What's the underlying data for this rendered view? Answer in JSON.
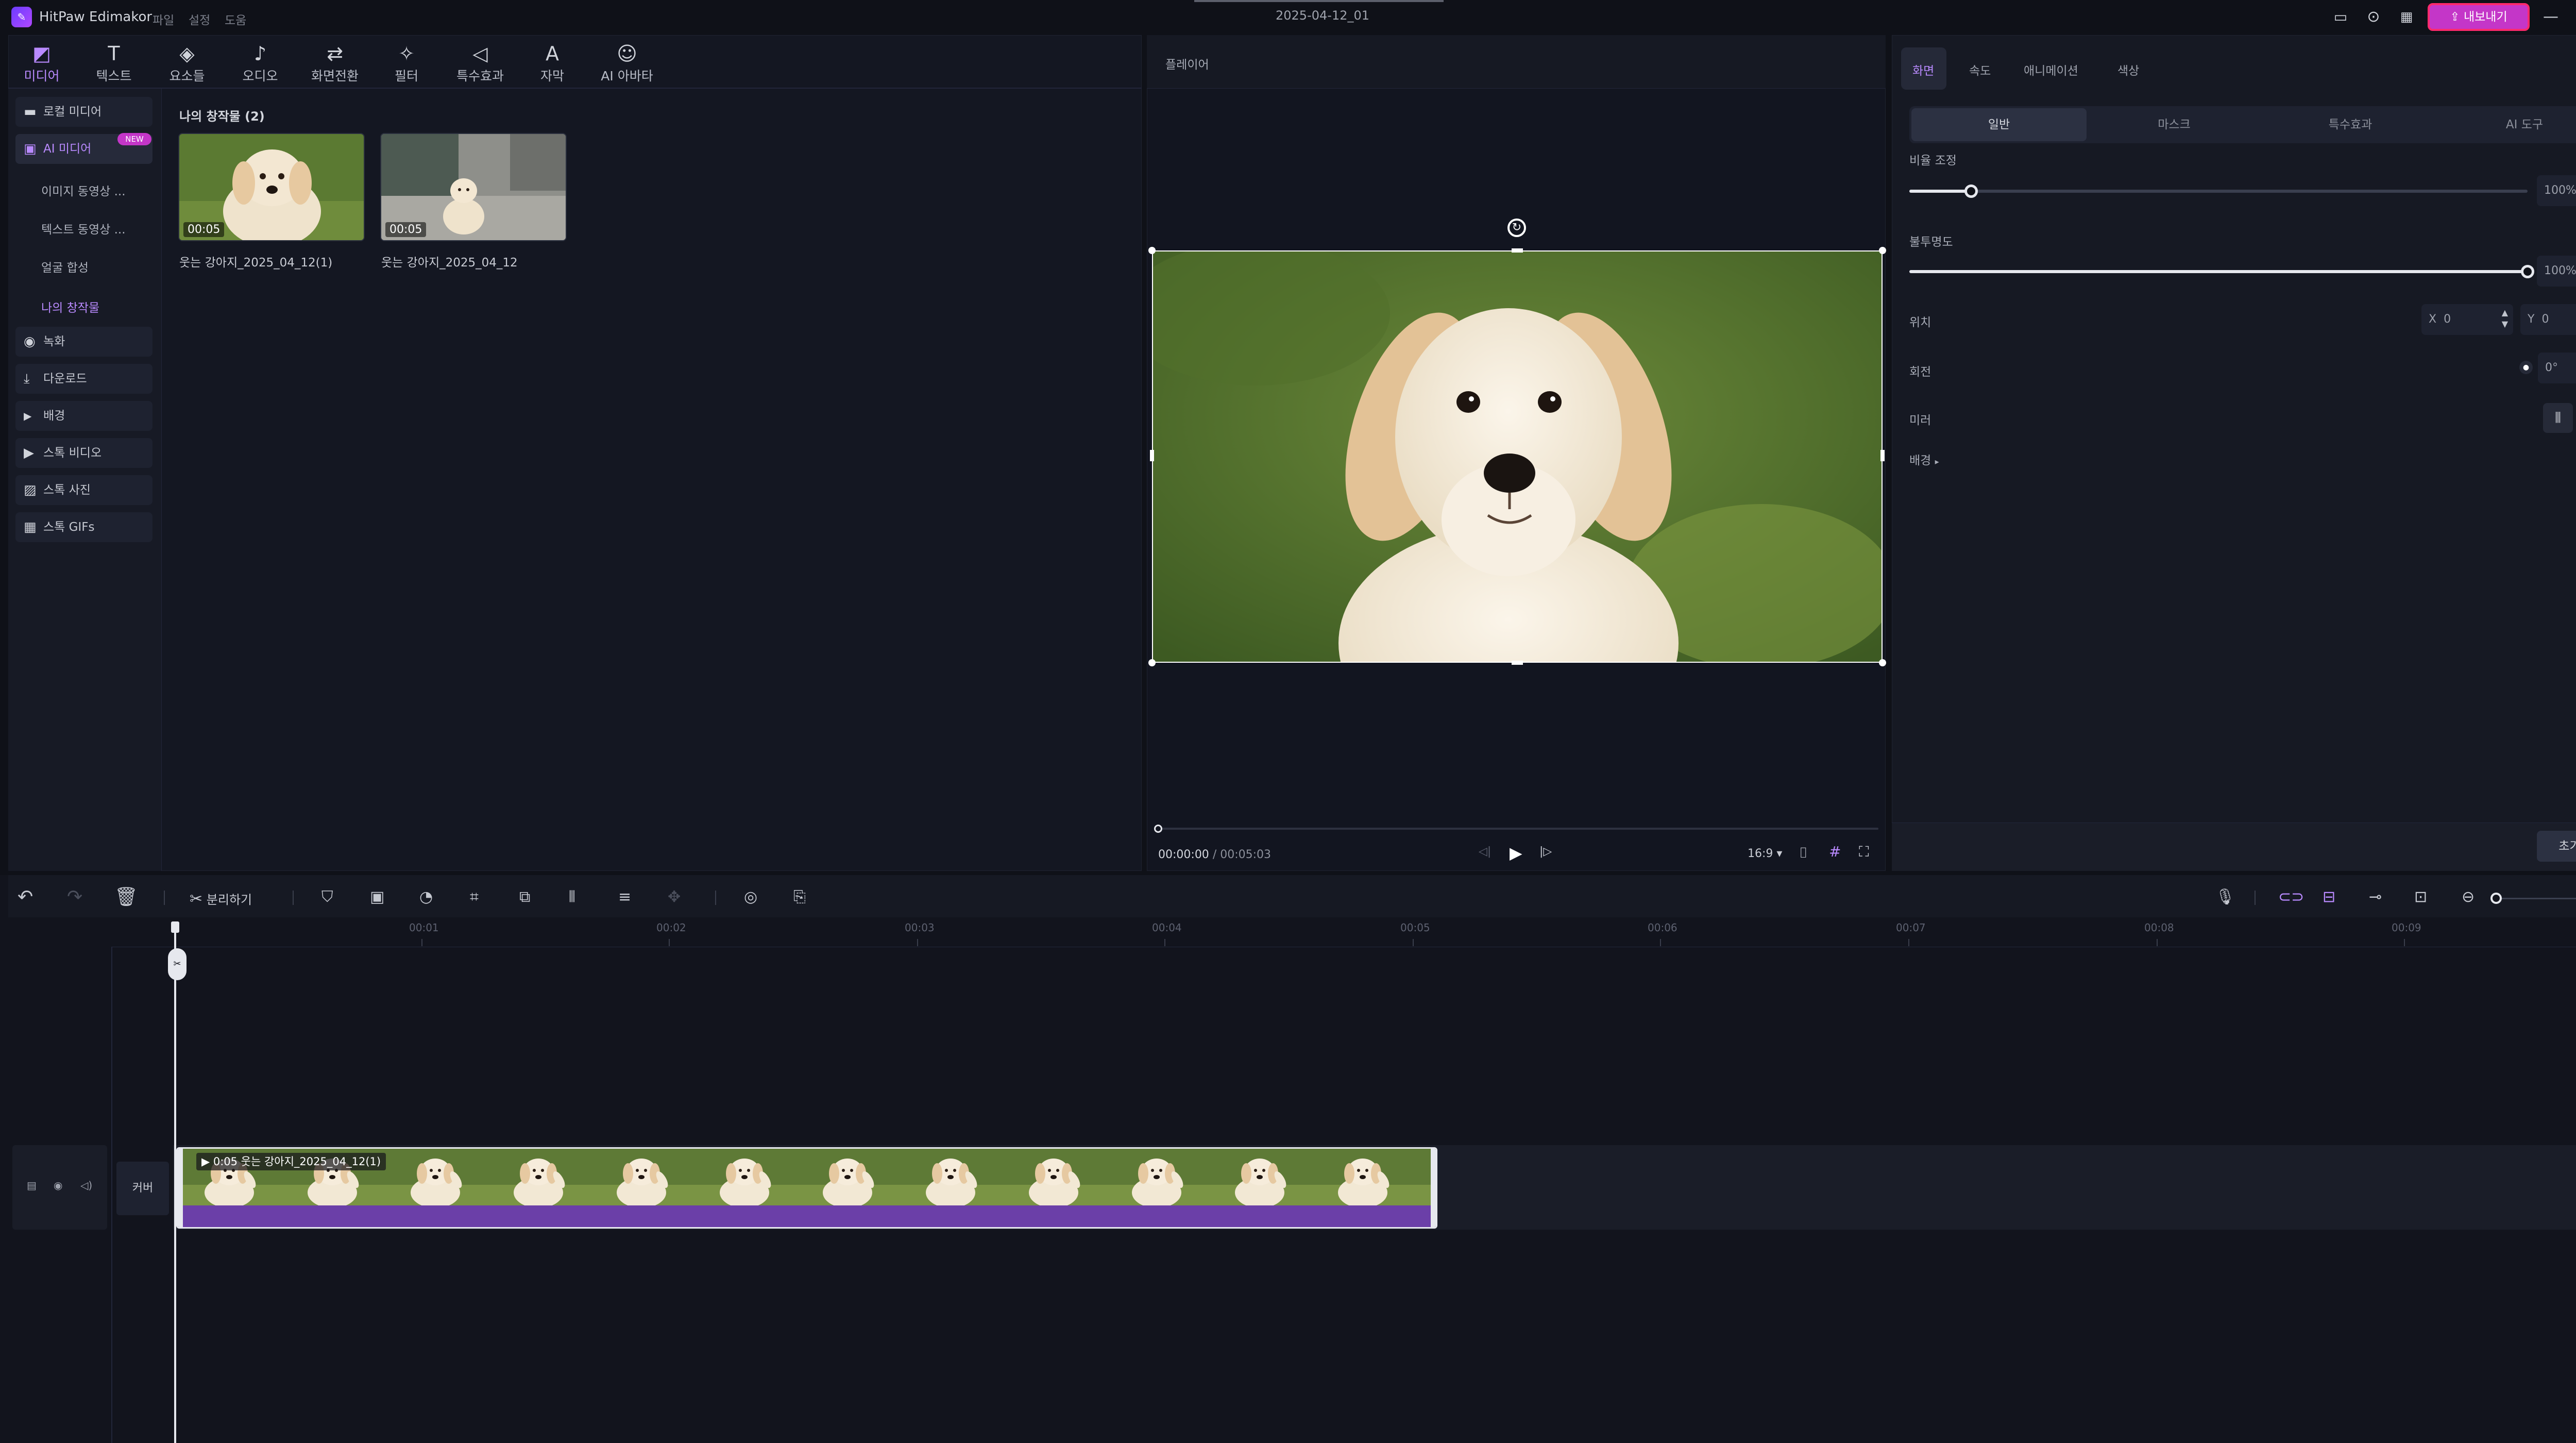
{
  "titlebar": {
    "app_name": "HitPaw Edimakor",
    "menus": [
      "파일",
      "설정",
      "도움"
    ],
    "project_title": "2025-04-12_01",
    "export_label": "내보내기"
  },
  "toolbar": {
    "items": [
      {
        "label": "미디어",
        "icon": "media-icon"
      },
      {
        "label": "텍스트",
        "icon": "text-icon"
      },
      {
        "label": "요소들",
        "icon": "elements-icon"
      },
      {
        "label": "오디오",
        "icon": "audio-icon"
      },
      {
        "label": "화면전환",
        "icon": "transition-icon"
      },
      {
        "label": "필터",
        "icon": "filter-icon"
      },
      {
        "label": "특수효과",
        "icon": "effects-icon"
      },
      {
        "label": "자막",
        "icon": "subtitle-icon"
      },
      {
        "label": "AI 아바타",
        "icon": "ai-avatar-icon"
      }
    ]
  },
  "sidebar": {
    "local_media": "로컬 미디어",
    "ai_media": "AI 미디어",
    "new_badge": "NEW",
    "sub_items": [
      "이미지 동영상 ...",
      "텍스트 동영상 ...",
      "얼굴 합성",
      "나의 창작물"
    ],
    "items": [
      "녹화",
      "다운로드",
      "배경",
      "스톡 비디오",
      "스톡 사진",
      "스톡 GIFs"
    ]
  },
  "library": {
    "section_title": "나의 창작물",
    "section_count": "(2)",
    "clips": [
      {
        "duration": "00:05",
        "name": "웃는 강아지_2025_04_12(1)"
      },
      {
        "duration": "00:05",
        "name": "웃는 강아지_2025_04_12"
      }
    ]
  },
  "player": {
    "title": "플레이어",
    "current_time": "00:00:00",
    "separator": "/",
    "total_time": "00:05:03",
    "aspect": "16:9",
    "progress": 0
  },
  "properties": {
    "tabs": [
      "화면",
      "속도",
      "애니메이션",
      "색상"
    ],
    "subtabs": [
      "일반",
      "마스크",
      "특수효과",
      "AI 도구"
    ],
    "scale_label": "비율 조정",
    "scale_value": "100%",
    "opacity_label": "불투명도",
    "opacity_value": "100%",
    "position_label": "위치",
    "x_label": "X",
    "x_value": "0",
    "y_label": "Y",
    "y_value": "0",
    "rotation_label": "회전",
    "rotation_value": "0°",
    "mirror_label": "미러",
    "background_label": "배경",
    "reset_label": "초기화",
    "scale_level": 0.1,
    "opacity_level": 1.0
  },
  "timeline": {
    "split_label": "분리하기",
    "ticks": [
      "00:01",
      "00:02",
      "00:03",
      "00:04",
      "00:05",
      "00:06",
      "00:07",
      "00:08",
      "00:09"
    ],
    "track_label": "커버",
    "clip_label": "0:05 웃는 강아지_2025_04_12(1)"
  },
  "colors": {
    "accent": "#b98aff",
    "export_fill": "#c436c8",
    "export_border": "#ff2a6d",
    "clip_bar": "#6b3fa8"
  }
}
